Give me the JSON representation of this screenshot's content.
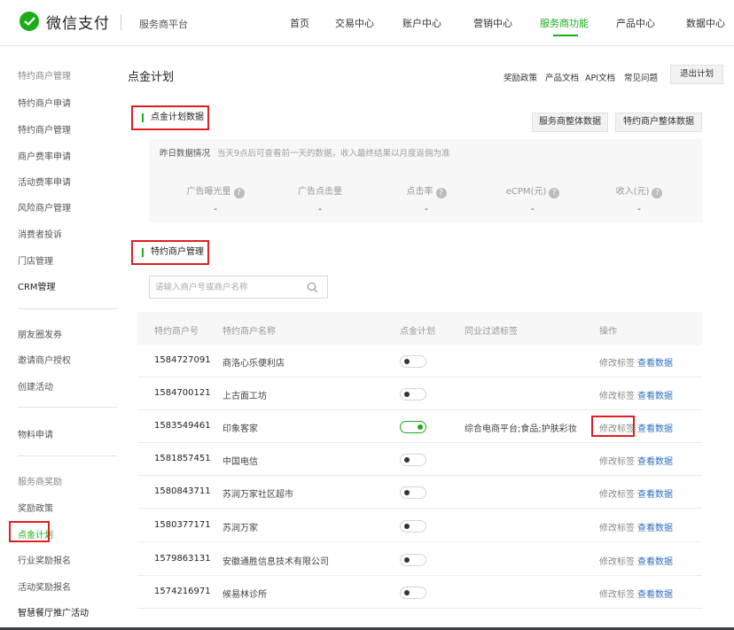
{
  "header": {
    "brand": "微信支付",
    "sub_brand": "服务商平台",
    "nav": [
      "首页",
      "交易中心",
      "账户中心",
      "营销中心",
      "服务商功能",
      "产品中心",
      "数据中心"
    ],
    "active_nav": "服务商功能"
  },
  "sidebar": {
    "items": [
      "特约商户管理",
      "特约商户申请",
      "特约商户管理",
      "商户费率申请",
      "活动费率申请",
      "风险商户管理",
      "消费者投诉",
      "门店管理",
      "CRM管理",
      "朋友圈发券",
      "邀请商户授权",
      "创建活动",
      "物料申请",
      "服务商奖励",
      "奖励政策",
      "点金计划",
      "行业奖励报名",
      "活动奖励报名",
      "智慧餐厅推广活动"
    ],
    "active": "点金计划"
  },
  "page": {
    "title": "点金计划",
    "links": [
      "奖励政策",
      "产品文档",
      "API文档",
      "常见问题"
    ],
    "exit_button": "退出计划"
  },
  "data_section": {
    "title": "点金计划数据",
    "buttons": [
      "服务商整体数据",
      "特约商户整体数据"
    ],
    "stats_header": "昨日数据情况",
    "stats_note": "当天9点后可查看前一天的数据，收入最终结果以月度返佣为准",
    "metrics": [
      {
        "label": "广告曝光量",
        "value": "-",
        "help": true
      },
      {
        "label": "广告点击量",
        "value": "-",
        "help": false
      },
      {
        "label": "点击率",
        "value": "-",
        "help": true
      },
      {
        "label": "eCPM(元)",
        "value": "-",
        "help": true
      },
      {
        "label": "收入(元)",
        "value": "-",
        "help": true
      }
    ]
  },
  "merchant_section": {
    "title": "特约商户管理",
    "search_placeholder": "请输入商户号或商户名称",
    "columns": [
      "特约商户号",
      "特约商户名称",
      "点金计划",
      "同业过滤标签",
      "操作"
    ],
    "edit_label": "修改标签",
    "view_label": "查看数据",
    "rows": [
      {
        "id": "1584727091",
        "name": "商洛心乐便利店",
        "enabled": false,
        "tags": ""
      },
      {
        "id": "1584700121",
        "name": "上古面工坊",
        "enabled": false,
        "tags": ""
      },
      {
        "id": "1583549461",
        "name": "印象客家",
        "enabled": true,
        "tags": "综合电商平台;食品;护肤彩妆"
      },
      {
        "id": "1581857451",
        "name": "中国电信",
        "enabled": false,
        "tags": ""
      },
      {
        "id": "1580843711",
        "name": "苏润万家社区超市",
        "enabled": false,
        "tags": ""
      },
      {
        "id": "1580377171",
        "name": "苏润万家",
        "enabled": false,
        "tags": ""
      },
      {
        "id": "1579863131",
        "name": "安徽通胜信息技术有限公司",
        "enabled": false,
        "tags": ""
      },
      {
        "id": "1574216971",
        "name": "候易林诊所",
        "enabled": false,
        "tags": ""
      }
    ]
  },
  "colors": {
    "accent": "#1aad19",
    "highlight": "#e02020",
    "link": "#2f6fbf"
  }
}
